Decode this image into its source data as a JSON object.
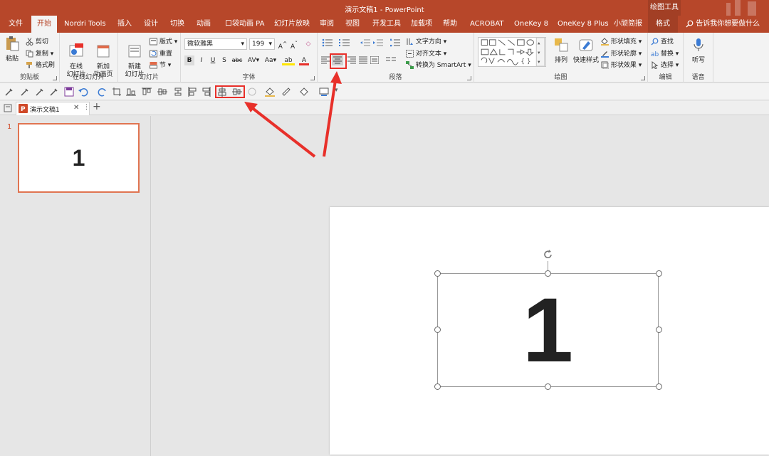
{
  "window": {
    "title": "演示文稿1  -  PowerPoint",
    "context_tab_group": "绘图工具"
  },
  "tabs": [
    "文件",
    "开始",
    "Nordri Tools",
    "插入",
    "设计",
    "切换",
    "动画",
    "口袋动画 PA",
    "幻灯片放映",
    "审阅",
    "视图",
    "开发工具",
    "加载项",
    "帮助",
    "ACROBAT",
    "OneKey 8",
    "OneKey 8 Plus",
    "小顽简报",
    "格式"
  ],
  "tell_me": "告诉我你想要做什么",
  "ribbon": {
    "clipboard": {
      "label": "剪贴板",
      "paste": "粘贴",
      "cut": "剪切",
      "copy": "复制",
      "format_painter": "格式刷"
    },
    "online_slides": {
      "label": "在线幻灯片",
      "online": "在线\n幻灯片",
      "new_anim": "新加\n动画页"
    },
    "slides": {
      "label": "幻灯片",
      "new_slide": "新建\n幻灯片",
      "layout": "版式",
      "reset": "重置",
      "section": "节"
    },
    "font": {
      "label": "字体",
      "font_name": "微软雅黑",
      "font_size": "199"
    },
    "paragraph": {
      "label": "段落",
      "text_direction": "文字方向",
      "align_text": "对齐文本",
      "smartart": "转换为 SmartArt"
    },
    "drawing": {
      "label": "绘图",
      "arrange": "排列",
      "quick_styles": "快速样式",
      "fill": "形状填充",
      "outline": "形状轮廓",
      "effects": "形状效果"
    },
    "editing": {
      "label": "编辑",
      "find": "查找",
      "replace": "替换",
      "select": "选择"
    },
    "voice": {
      "label": "语音",
      "dictate": "听写"
    }
  },
  "doc_tab": {
    "name": "演示文稿1"
  },
  "thumbnails": [
    {
      "number": "1",
      "text": "1"
    }
  ],
  "slide": {
    "text": "1"
  },
  "colors": {
    "accent": "#b7472a",
    "highlight": "#e8302a"
  }
}
